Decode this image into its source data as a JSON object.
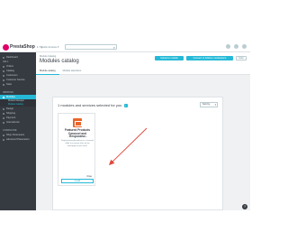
{
  "brand": {
    "name": "PrestaShop",
    "version": "1.7.x"
  },
  "topbar": {
    "quick_access": "Quick Access ▾",
    "search_placeholder": "Search (e.g.: product reference, custom"
  },
  "sidebar": {
    "sections": [
      {
        "label": "SELL",
        "items": [
          "Orders",
          "Catalog",
          "Customers",
          "Customer Service",
          "Stats"
        ]
      },
      {
        "label": "IMPROVE",
        "items": [
          "Modules",
          "Design",
          "Shipping",
          "Payment",
          "International"
        ]
      },
      {
        "label": "CONFIGURE",
        "items": [
          "Shop Parameters",
          "Advanced Parameters"
        ]
      }
    ],
    "dashboard": "Dashboard",
    "subitems": [
      "Module Manager",
      "Module Catalog"
    ]
  },
  "header": {
    "breadcrumb": "Module Catalog",
    "title": "Modules catalog",
    "buttons": {
      "upload": "Upload a module",
      "connect": "Connect to Addons marketplace",
      "help": "Help"
    },
    "tabs": [
      "Module catalog",
      "Module selections"
    ]
  },
  "content": {
    "panel_title": "1 modules and services selected for you",
    "info": "i",
    "sort_label": "Sort by",
    "module": {
      "name": "Featured Products Carousel and Responsive",
      "meta": "v 1.1 · by Bilal Ahmed",
      "description": "Display featured products in a carousel slider to increase visits on the homepage of your store.",
      "price": "Free",
      "install": "Install"
    }
  },
  "help_icon": "?",
  "colors": {
    "accent": "#25b9d7",
    "sidebar": "#363a41",
    "brand": "#df0067",
    "arrow": "#e0463c",
    "module_icon": "#e9662b"
  }
}
